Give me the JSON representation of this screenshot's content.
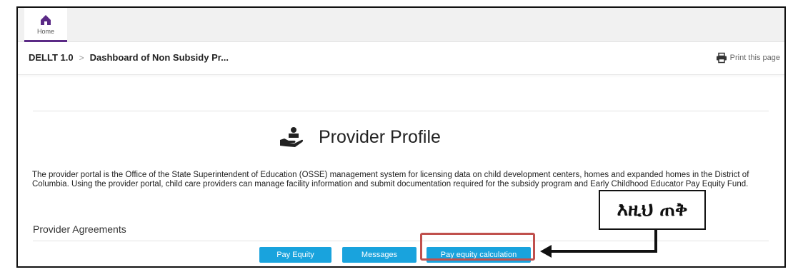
{
  "nav": {
    "home_label": "Home"
  },
  "breadcrumb": {
    "root": "DELLT 1.0",
    "current": "Dashboard of Non Subsidy Pr..."
  },
  "print": {
    "label": "Print this page"
  },
  "profile": {
    "title": "Provider Profile",
    "intro": "The provider portal is the Office of the State Superintendent of Education (OSSE) management system for licensing data on child development centers, homes and expanded homes in the District of Columbia. Using the provider portal, child care providers can manage facility information and submit documentation required for the subsidy program and Early Childhood Educator Pay Equity Fund."
  },
  "agreements": {
    "title": "Provider Agreements",
    "buttons": [
      "Pay Equity",
      "Messages",
      "Pay equity calculation"
    ]
  },
  "annotation": {
    "callout": "እዚህ ጠቅ"
  },
  "colors": {
    "button": "#19a3dd",
    "highlight": "#c0504d",
    "brand": "#5b2a86"
  }
}
